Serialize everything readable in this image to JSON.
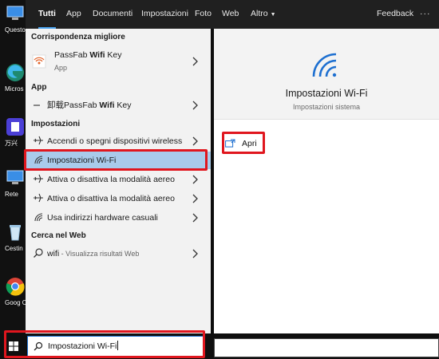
{
  "desktop": {
    "items": [
      {
        "label": "Questo"
      },
      {
        "label": "Micros Edge"
      },
      {
        "label": "万兴"
      },
      {
        "label": "Rete"
      },
      {
        "label": "Cestin"
      },
      {
        "label": "Goog Chron"
      }
    ]
  },
  "topbar": {
    "tabs": [
      "Tutti",
      "App",
      "Documenti",
      "Impostazioni",
      "Foto",
      "Web",
      "Altro"
    ],
    "feedback": "Feedback",
    "more": "···"
  },
  "results": {
    "best_match_header": "Corrispondenza migliore",
    "best_match": {
      "name_prefix": "PassFab ",
      "name_bold": "Wifi",
      "name_suffix": " Key",
      "type": "App"
    },
    "app_header": "App",
    "app_item": {
      "name_prefix": "卸载PassFab ",
      "name_bold": "Wifi",
      "name_suffix": " Key"
    },
    "settings_header": "Impostazioni",
    "settings_items": [
      "Accendi o spegni dispositivi wireless",
      "Impostazioni Wi-Fi",
      "Attiva o disattiva la modalità aereo",
      "Attiva o disattiva la modalità aereo",
      "Usa indirizzi hardware casuali"
    ],
    "web_header": "Cerca nel Web",
    "web_item": {
      "query": "wifi",
      "hint": " - Visualizza risultati Web"
    }
  },
  "detail": {
    "title": "Impostazioni Wi-Fi",
    "subtitle": "Impostazioni sistema",
    "open_label": "Apri"
  },
  "search": {
    "value": "Impostazioni Wi-Fi"
  },
  "colors": {
    "accent": "#1d6fd0",
    "highlight_border": "#e0161e",
    "selected_row": "#a9cbeb",
    "tab_underline": "#4aa3f0"
  }
}
